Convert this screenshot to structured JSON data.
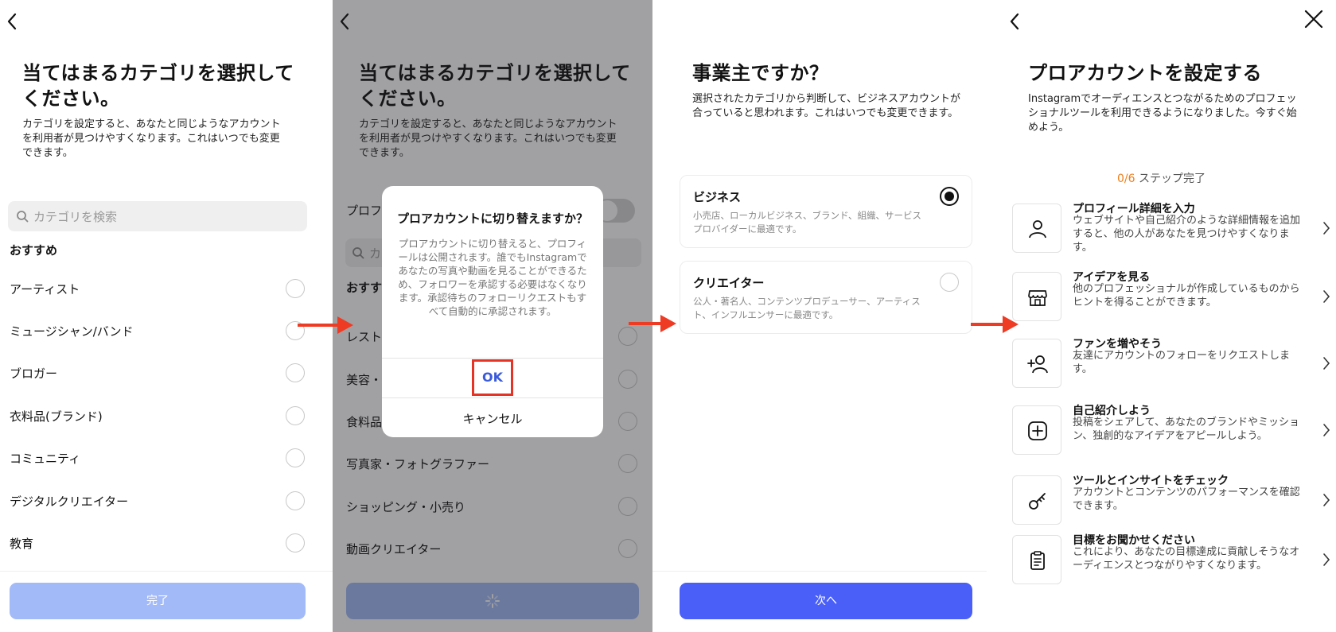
{
  "panel1": {
    "title": "当てはまるカテゴリを選択してください。",
    "description": "カテゴリを設定すると、あなたと同じようなアカウントを利用者が見つけやすくなります。これはいつでも変更できます。",
    "search_placeholder": "カテゴリを検索",
    "section": "おすすめ",
    "categories": [
      "アーティスト",
      "ミュージシャン/バンド",
      "ブロガー",
      "衣料品(ブランド)",
      "コミュニティ",
      "デジタルクリエイター",
      "教育"
    ],
    "done_button": "完了"
  },
  "panel2": {
    "title": "当てはまるカテゴリを選択してください。",
    "description": "カテゴリを設定すると、あなたと同じようなアカウントを利用者が見つけやすくなります。これはいつでも変更できます。",
    "toggle_label": "プロフ",
    "search_label": "カ",
    "section": "おすす",
    "categories": [
      "レスト",
      "美容・",
      "食料品",
      "写真家・フォトグラファー",
      "ショッピング・小売り",
      "動画クリエイター"
    ],
    "dialog": {
      "title": "プロアカウントに切り替えますか？",
      "body": "プロアカウントに切り替えると、プロフィールは公開されます。誰でもInstagramであなたの写真や動画を見ることができるため、フォロワーを承認する必要はなくなります。承認待ちのフォローリクエストもすべて自動的に承認されます。",
      "ok": "OK",
      "cancel": "キャンセル"
    }
  },
  "panel3": {
    "title": "事業主ですか？",
    "description": "選択されたカテゴリから判断して、ビジネスアカウントが合っていると思われます。これはいつでも変更できます。",
    "options": [
      {
        "title": "ビジネス",
        "subtitle": "小売店、ローカルビジネス、ブランド、組織、サービスプロバイダーに最適です。",
        "selected": true
      },
      {
        "title": "クリエイター",
        "subtitle": "公人・著名人、コンテンツプロデューサー、アーティスト、インフルエンサーに最適です。",
        "selected": false
      }
    ],
    "next_button": "次へ"
  },
  "panel4": {
    "title": "プロアカウントを設定する",
    "description": "Instagramでオーディエンスとつながるためのプロフェッショナルツールを利用できるようになりました。今すぐ始めよう。",
    "steps_done": "0/6",
    "steps_label": "ステップ完了",
    "items": [
      {
        "title": "プロフィール詳細を入力",
        "subtitle": "ウェブサイトや自己紹介のような詳細情報を追加すると、他の人があなたを見つけやすくなります。",
        "icon": "person-icon"
      },
      {
        "title": "アイデアを見る",
        "subtitle": "他のプロフェッショナルが作成しているものからヒントを得ることができます。",
        "icon": "shop-icon"
      },
      {
        "title": "ファンを増やそう",
        "subtitle": "友達にアカウントのフォローをリクエストします。",
        "icon": "add-person-icon"
      },
      {
        "title": "自己紹介しよう",
        "subtitle": "投稿をシェアして、あなたのブランドやミッション、独創的なアイデアをアピールしよう。",
        "icon": "plus-square-icon"
      },
      {
        "title": "ツールとインサイトをチェック",
        "subtitle": "アカウントとコンテンツのパフォーマンスを確認できます。",
        "icon": "key-icon"
      },
      {
        "title": "目標をお聞かせください",
        "subtitle": "これにより、あなたの目標達成に貢献しそうなオーディエンスとつながりやすくなります。",
        "icon": "clipboard-icon"
      }
    ]
  },
  "colors": {
    "primary_blue": "#4a5ff7",
    "disabled_blue": "#a3baf9",
    "arrow_red": "#ee3b24",
    "highlight_red": "#e53326",
    "step_orange": "#f07e1a"
  }
}
